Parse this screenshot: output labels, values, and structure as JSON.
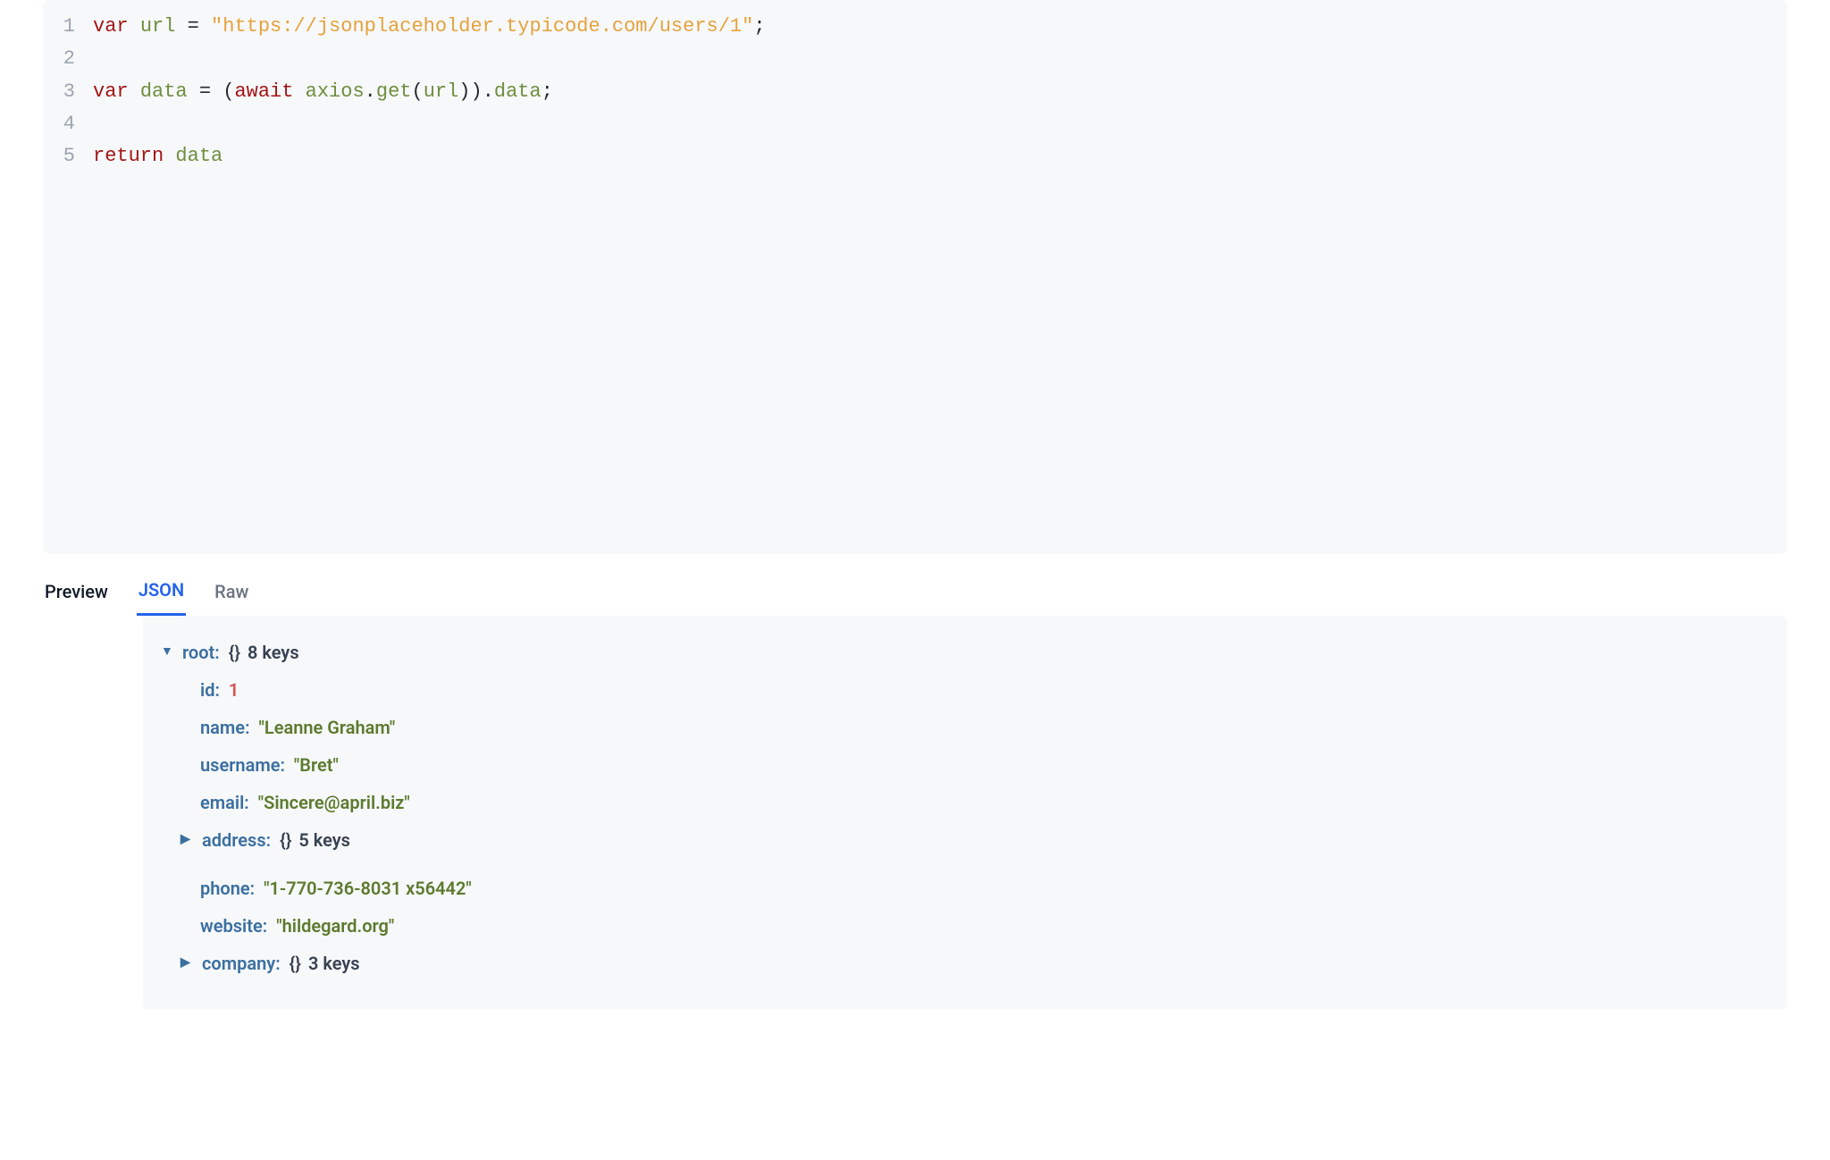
{
  "code": {
    "lines": [
      {
        "n": "1",
        "tokens": [
          {
            "t": "var",
            "c": "tok-keyword"
          },
          {
            "t": " ",
            "c": ""
          },
          {
            "t": "url",
            "c": "tok-ident"
          },
          {
            "t": " = ",
            "c": "tok-punct"
          },
          {
            "t": "\"https://jsonplaceholder.typicode.com/users/1\"",
            "c": "tok-string"
          },
          {
            "t": ";",
            "c": "tok-punct"
          }
        ]
      },
      {
        "n": "2",
        "tokens": []
      },
      {
        "n": "3",
        "tokens": [
          {
            "t": "var",
            "c": "tok-keyword"
          },
          {
            "t": " ",
            "c": ""
          },
          {
            "t": "data",
            "c": "tok-ident"
          },
          {
            "t": " = (",
            "c": "tok-punct"
          },
          {
            "t": "await",
            "c": "tok-await"
          },
          {
            "t": " ",
            "c": ""
          },
          {
            "t": "axios",
            "c": "tok-ident"
          },
          {
            "t": ".",
            "c": "tok-punct"
          },
          {
            "t": "get",
            "c": "tok-ident"
          },
          {
            "t": "(",
            "c": "tok-punct"
          },
          {
            "t": "url",
            "c": "tok-ident"
          },
          {
            "t": ")).",
            "c": "tok-punct"
          },
          {
            "t": "data",
            "c": "tok-ident"
          },
          {
            "t": ";",
            "c": "tok-punct"
          }
        ]
      },
      {
        "n": "4",
        "tokens": []
      },
      {
        "n": "5",
        "tokens": [
          {
            "t": "return",
            "c": "tok-keyword"
          },
          {
            "t": " ",
            "c": ""
          },
          {
            "t": "data",
            "c": "tok-ident"
          }
        ]
      }
    ]
  },
  "tabs": {
    "preview": "Preview",
    "json": "JSON",
    "raw": "Raw"
  },
  "json": {
    "root_label": "root",
    "root_meta": "8 keys",
    "braces": "{}",
    "fields": {
      "id_key": "id",
      "id_val": "1",
      "name_key": "name",
      "name_val": "\"Leanne Graham\"",
      "username_key": "username",
      "username_val": "\"Bret\"",
      "email_key": "email",
      "email_val": "\"Sincere@april.biz\"",
      "address_key": "address",
      "address_meta": "5 keys",
      "phone_key": "phone",
      "phone_val": "\"1-770-736-8031 x56442\"",
      "website_key": "website",
      "website_val": "\"hildegard.org\"",
      "company_key": "company",
      "company_meta": "3 keys"
    }
  }
}
